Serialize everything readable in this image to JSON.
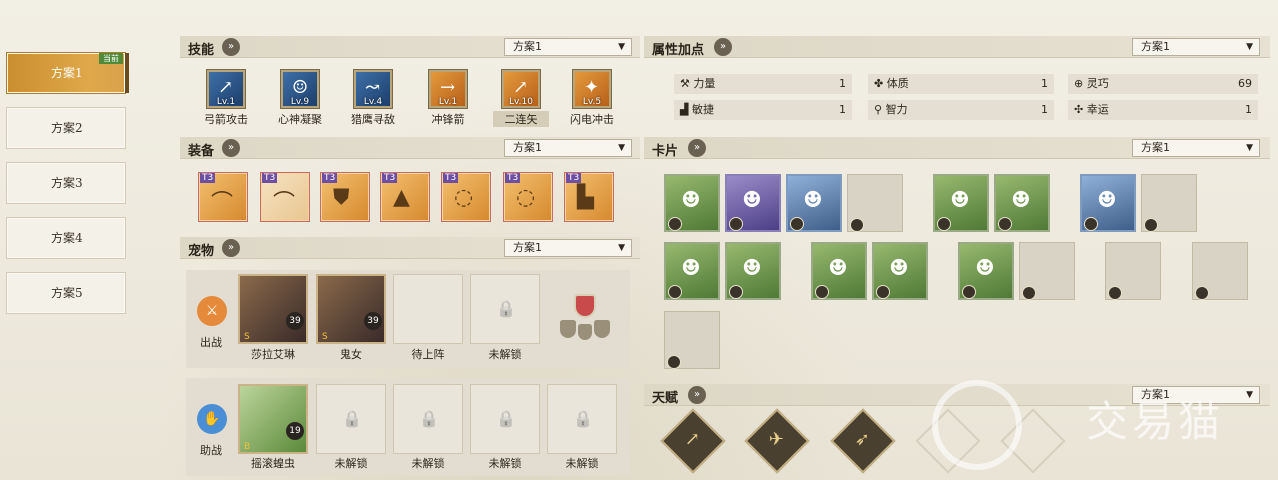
{
  "plans": {
    "items": [
      "方案1",
      "方案2",
      "方案3",
      "方案4",
      "方案5"
    ],
    "current_tag": "当前"
  },
  "skills": {
    "title": "技能",
    "dropdown": "方案1",
    "items": [
      {
        "name": "弓箭攻击",
        "level": "Lv.1"
      },
      {
        "name": "心神凝聚",
        "level": "Lv.9"
      },
      {
        "name": "猎鹰寻敌",
        "level": "Lv.4"
      },
      {
        "name": "冲锋箭",
        "level": "Lv.1"
      },
      {
        "name": "二连矢",
        "level": "Lv.10"
      },
      {
        "name": "闪电冲击",
        "level": "Lv.5"
      }
    ]
  },
  "equipment": {
    "title": "装备",
    "dropdown": "方案1",
    "tier": "T3"
  },
  "pets": {
    "title": "宠物",
    "dropdown": "方案1",
    "battle_label": "出战",
    "assist_label": "助战",
    "battle": [
      {
        "name": "莎拉艾琳",
        "level": "39",
        "grade": "S"
      },
      {
        "name": "鬼女",
        "level": "39",
        "grade": "S"
      },
      {
        "name": "待上阵"
      },
      {
        "name": "未解锁"
      }
    ],
    "assist": [
      {
        "name": "摇滚蝗虫",
        "level": "19",
        "grade": "B"
      },
      {
        "name": "未解锁"
      },
      {
        "name": "未解锁"
      },
      {
        "name": "未解锁"
      },
      {
        "name": "未解锁"
      }
    ]
  },
  "attributes": {
    "title": "属性加点",
    "dropdown": "方案1",
    "rows": [
      {
        "label": "力量",
        "value": "1"
      },
      {
        "label": "体质",
        "value": "1"
      },
      {
        "label": "灵巧",
        "value": "69"
      },
      {
        "label": "敏捷",
        "value": "1"
      },
      {
        "label": "智力",
        "value": "1"
      },
      {
        "label": "幸运",
        "value": "1"
      }
    ]
  },
  "cards": {
    "title": "卡片",
    "dropdown": "方案1"
  },
  "talent": {
    "title": "天赋",
    "dropdown": "方案1"
  },
  "watermark": "交易猫"
}
